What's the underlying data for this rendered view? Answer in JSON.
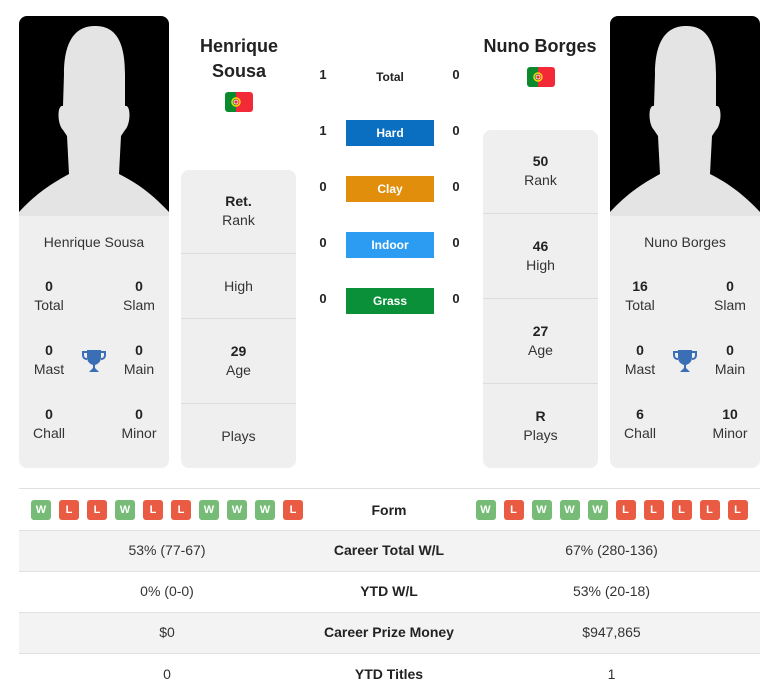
{
  "players": {
    "left": {
      "name": "Henrique Sousa",
      "name_line1": "Henrique",
      "name_line2": "Sousa",
      "flag": "portugal-flag",
      "titles": {
        "total": {
          "value": "0",
          "label": "Total"
        },
        "slam": {
          "value": "0",
          "label": "Slam"
        },
        "mast": {
          "value": "0",
          "label": "Mast"
        },
        "main": {
          "value": "0",
          "label": "Main"
        },
        "chall": {
          "value": "0",
          "label": "Chall"
        },
        "minor": {
          "value": "0",
          "label": "Minor"
        }
      },
      "stats": {
        "rank": {
          "value": "Ret.",
          "label": "Rank"
        },
        "high": {
          "value": "",
          "label": "High"
        },
        "age": {
          "value": "29",
          "label": "Age"
        },
        "plays": {
          "value": "",
          "label": "Plays"
        }
      },
      "form": [
        "W",
        "L",
        "L",
        "W",
        "L",
        "L",
        "W",
        "W",
        "W",
        "L"
      ]
    },
    "right": {
      "name": "Nuno Borges",
      "flag": "portugal-flag",
      "titles": {
        "total": {
          "value": "16",
          "label": "Total"
        },
        "slam": {
          "value": "0",
          "label": "Slam"
        },
        "mast": {
          "value": "0",
          "label": "Mast"
        },
        "main": {
          "value": "0",
          "label": "Main"
        },
        "chall": {
          "value": "6",
          "label": "Chall"
        },
        "minor": {
          "value": "10",
          "label": "Minor"
        }
      },
      "stats": {
        "rank": {
          "value": "50",
          "label": "Rank"
        },
        "high": {
          "value": "46",
          "label": "High"
        },
        "age": {
          "value": "27",
          "label": "Age"
        },
        "plays": {
          "value": "R",
          "label": "Plays"
        }
      },
      "form": [
        "W",
        "L",
        "W",
        "W",
        "W",
        "L",
        "L",
        "L",
        "L",
        "L"
      ]
    }
  },
  "h2h": {
    "total": {
      "label": "Total",
      "left": "1",
      "right": "0"
    },
    "surfaces": [
      {
        "label": "Hard",
        "left": "1",
        "right": "0",
        "color": "#0a6ec1"
      },
      {
        "label": "Clay",
        "left": "0",
        "right": "0",
        "color": "#e08e0b"
      },
      {
        "label": "Indoor",
        "left": "0",
        "right": "0",
        "color": "#2b9cf2"
      },
      {
        "label": "Grass",
        "left": "0",
        "right": "0",
        "color": "#0a9038"
      }
    ]
  },
  "comparison": {
    "form_label": "Form",
    "rows": [
      {
        "label": "Career Total W/L",
        "left": "53% (77-67)",
        "right": "67% (280-136)"
      },
      {
        "label": "YTD W/L",
        "left": "0% (0-0)",
        "right": "53% (20-18)"
      },
      {
        "label": "Career Prize Money",
        "left": "$0",
        "right": "$947,865"
      },
      {
        "label": "YTD Titles",
        "left": "0",
        "right": "1"
      }
    ]
  },
  "colors": {
    "win": "#76bb76",
    "loss": "#e95c43",
    "trophy": "#3a6fb5"
  }
}
